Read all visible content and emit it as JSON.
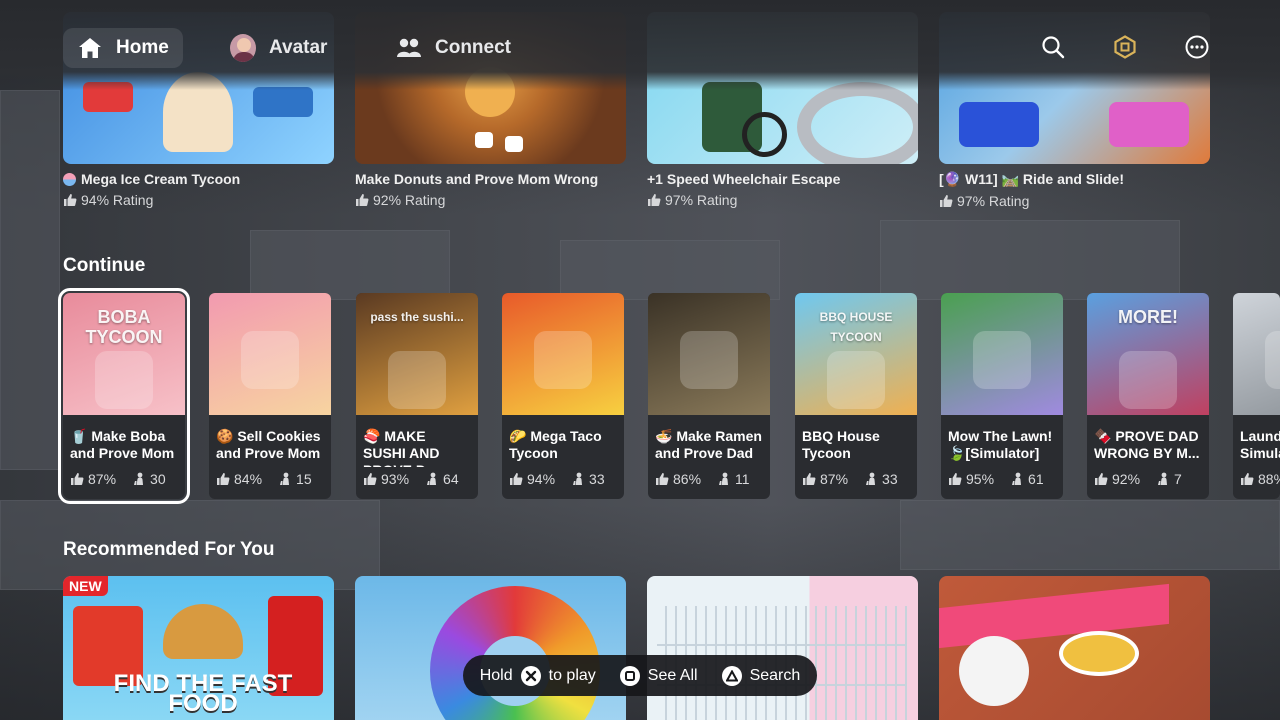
{
  "nav": {
    "home": "Home",
    "avatar": "Avatar",
    "connect": "Connect"
  },
  "top_games": [
    {
      "title": "Mega Ice Cream Tycoon",
      "rating": "94% Rating",
      "colors": [
        "#3d8ae0",
        "#8fd3ff"
      ]
    },
    {
      "title": "Make Donuts and Prove Mom Wrong",
      "rating": "92% Rating",
      "colors": [
        "#6b3a1e",
        "#e8a24a"
      ]
    },
    {
      "title": "+1 Speed Wheelchair Escape",
      "rating": "97% Rating",
      "colors": [
        "#7fd6f0",
        "#cfeef7"
      ]
    },
    {
      "title": "[🔮 W11] 🛤️ Ride and Slide!",
      "rating": "97% Rating",
      "colors": [
        "#4d9fe0",
        "#e07a3a"
      ]
    }
  ],
  "continue": {
    "title": "Continue",
    "items": [
      {
        "title": "🥤 Make Boba and Prove Mom",
        "rating": "87%",
        "players": "30",
        "colors": [
          "#e88b9b",
          "#f7c1c8"
        ],
        "thumb_text": "BOBA TYCOON",
        "selected": true
      },
      {
        "title": "🍪 Sell Cookies and Prove Mom",
        "rating": "84%",
        "players": "15",
        "colors": [
          "#f29ab0",
          "#f7d4a0"
        ],
        "thumb_text": ""
      },
      {
        "title": "🍣 MAKE SUSHI AND PROVE D...",
        "rating": "93%",
        "players": "64",
        "colors": [
          "#5a3a22",
          "#e0a040"
        ],
        "thumb_text": "pass the sushi..."
      },
      {
        "title": "🌮 Mega Taco Tycoon",
        "rating": "94%",
        "players": "33",
        "colors": [
          "#e85a2a",
          "#f7d040"
        ],
        "thumb_text": ""
      },
      {
        "title": "🍜 Make Ramen and Prove Dad",
        "rating": "86%",
        "players": "11",
        "colors": [
          "#3a3226",
          "#8a7a5a"
        ],
        "thumb_text": ""
      },
      {
        "title": "BBQ House Tycoon",
        "rating": "87%",
        "players": "33",
        "colors": [
          "#6fc8f0",
          "#f0b050"
        ],
        "thumb_text": "BBQ HOUSE TYCOON"
      },
      {
        "title": "Mow The Lawn! 🍃[Simulator]",
        "rating": "95%",
        "players": "61",
        "colors": [
          "#4aa050",
          "#a08ae0"
        ],
        "thumb_text": ""
      },
      {
        "title": "🍫 PROVE DAD WRONG BY M...",
        "rating": "92%",
        "players": "7",
        "colors": [
          "#5aa0e0",
          "#c04060"
        ],
        "thumb_text": "MORE!"
      },
      {
        "title": "Laundry Simulator",
        "title_visible": "Laund Simula",
        "rating": "88%",
        "players": "",
        "colors": [
          "#cfd4da",
          "#8a9096"
        ],
        "thumb_text": ""
      }
    ]
  },
  "recommended": {
    "title": "Recommended For You",
    "items": [
      {
        "badge": "NEW",
        "thumb_text": "FIND THE FAST FOOD",
        "colors": [
          "#5cc0f0",
          "#e03030"
        ]
      },
      {
        "thumb_text": "",
        "colors": [
          "#6cb8e8",
          "#f0d040"
        ]
      },
      {
        "thumb_text": "",
        "colors": [
          "#eaf2f6",
          "#f6cfe0"
        ]
      },
      {
        "thumb_text": "",
        "colors": [
          "#c05a3a",
          "#f04a7a"
        ]
      }
    ]
  },
  "hints": {
    "hold": "Hold",
    "to_play": "to play",
    "see_all": "See All",
    "search": "Search"
  },
  "icons": {
    "home": "home-icon",
    "connect": "people-icon",
    "search": "search-icon",
    "robux": "robux-icon",
    "more": "more-icon",
    "like": "thumbs-up-icon",
    "players": "players-icon"
  }
}
